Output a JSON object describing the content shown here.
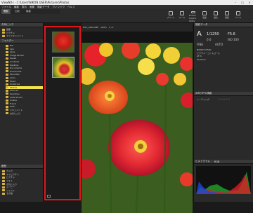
{
  "window": {
    "title": "ViewNX-i - C:\\Users\\NIKON USER\\Pictures\\Photos"
  },
  "menu": [
    "ファイル",
    "編集",
    "表示",
    "画像",
    "撮影データ",
    "ウィンドウ",
    "ヘルプ"
  ],
  "tabs": [
    "閲覧",
    "比較",
    "編集"
  ],
  "toolbar": {
    "tools": [
      "プリント",
      "メール",
      "Picture Control Utility",
      "転送",
      "送信",
      "動画",
      "ツール"
    ]
  },
  "left_panel": {
    "favorites_title": "お気に入り",
    "favorites": [
      "画像",
      "ピクチャ",
      "マイドキュメント"
    ],
    "folders_title": "フォルダー",
    "folders": [
      "Nik",
      "App",
      "Apps",
      "Image Binder",
      "Saved",
      "Contacts",
      "Desktop",
      "Documents",
      "Downloads",
      "Favorites",
      "Links",
      "Music",
      "OneDrive",
      "Photos",
      "Pictures",
      "Searches",
      "Slide Shows",
      "Videos",
      "Travel",
      "ToDo",
      "ドキュメント",
      "お気に入り"
    ],
    "selected_folder": "Photos",
    "history_title": "履歴",
    "history": [
      "カメラ",
      "マイピクチャ",
      "ピクチャ",
      "フォト",
      "お気に入り",
      "ムービー",
      "ファイル",
      "その他"
    ]
  },
  "viewer": {
    "file_label": "DSC_0001.NEF",
    "zoom": "100%",
    "nav": "1 / 2"
  },
  "right_panel": {
    "title": "撮影データ",
    "mode": "A",
    "shutter": "1/1250",
    "aperture": "F5.6",
    "exposure_comp": "0.0",
    "iso": "ISO 100",
    "quality": "FINE",
    "white_balance": "AUTO",
    "info_lines": [
      "NIKON D7500",
      "ピクチャーコントロール",
      "AF-S",
      "50.0mm"
    ],
    "metadata_title": "XMP/IPTC情報",
    "rating_label": "レーティング",
    "histogram_title": "ヒストグラム",
    "histogram_mode": "RGB"
  },
  "colors": {
    "highlight": "#f2e24b",
    "film_border": "#e0161c"
  }
}
